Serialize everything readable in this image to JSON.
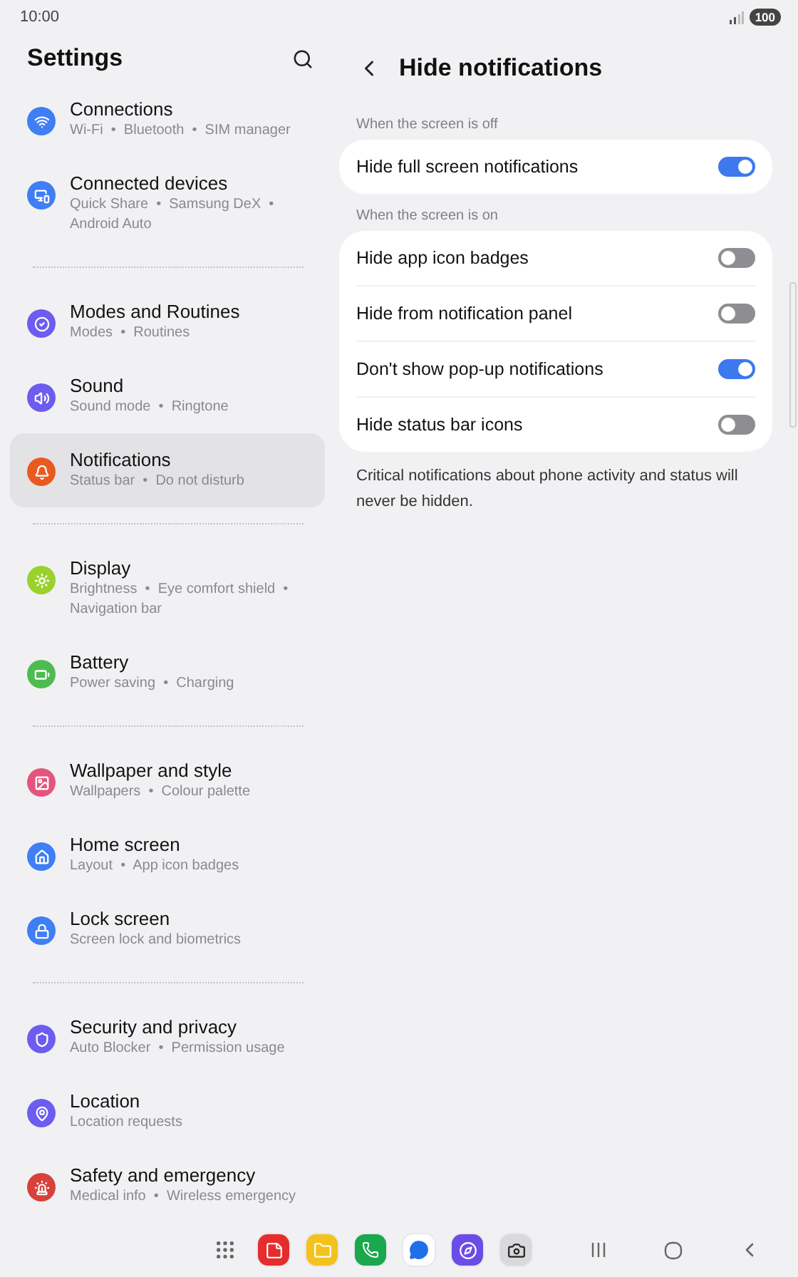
{
  "status_bar": {
    "time": "10:00",
    "battery": "100"
  },
  "sidebar": {
    "title": "Settings",
    "groups": [
      {
        "items": [
          {
            "title": "Connections",
            "subtitle": "Wi-Fi  •  Bluetooth  •  SIM manager",
            "color": "#3f7ef4",
            "selected": false
          },
          {
            "title": "Connected devices",
            "subtitle": "Quick Share  •  Samsung DeX  •  Android Auto",
            "color": "#3f7ef4",
            "selected": false
          }
        ]
      },
      {
        "items": [
          {
            "title": "Modes and Routines",
            "subtitle": "Modes  •  Routines",
            "color": "#6d5cf0",
            "selected": false
          },
          {
            "title": "Sound",
            "subtitle": "Sound mode  •  Ringtone",
            "color": "#6d5cf0",
            "selected": false
          },
          {
            "title": "Notifications",
            "subtitle": "Status bar  •  Do not disturb",
            "color": "#ea5a1f",
            "selected": true
          }
        ]
      },
      {
        "items": [
          {
            "title": "Display",
            "subtitle": "Brightness  •  Eye comfort shield  •  Navigation bar",
            "color": "#9ad12c",
            "selected": false
          },
          {
            "title": "Battery",
            "subtitle": "Power saving  •  Charging",
            "color": "#4dbb4f",
            "selected": false
          }
        ]
      },
      {
        "items": [
          {
            "title": "Wallpaper and style",
            "subtitle": "Wallpapers  •  Colour palette",
            "color": "#e5547c",
            "selected": false
          },
          {
            "title": "Home screen",
            "subtitle": "Layout  •  App icon badges",
            "color": "#3f7ef4",
            "selected": false
          },
          {
            "title": "Lock screen",
            "subtitle": "Screen lock and biometrics",
            "color": "#3f7ef4",
            "selected": false
          }
        ]
      },
      {
        "items": [
          {
            "title": "Security and privacy",
            "subtitle": "Auto Blocker  •  Permission usage",
            "color": "#6d5cf0",
            "selected": false
          },
          {
            "title": "Location",
            "subtitle": "Location requests",
            "color": "#6d5cf0",
            "selected": false
          },
          {
            "title": "Safety and emergency",
            "subtitle": "Medical info  •  Wireless emergency",
            "color": "#d8413b",
            "selected": false
          }
        ]
      }
    ]
  },
  "detail": {
    "title": "Hide notifications",
    "sections": [
      {
        "label": "When the screen is off",
        "rows": [
          {
            "label": "Hide full screen notifications",
            "on": true
          }
        ]
      },
      {
        "label": "When the screen is on",
        "rows": [
          {
            "label": "Hide app icon badges",
            "on": false
          },
          {
            "label": "Hide from notification panel",
            "on": false
          },
          {
            "label": "Don't show pop-up notifications",
            "on": true
          },
          {
            "label": "Hide status bar icons",
            "on": false
          }
        ]
      }
    ],
    "footnote": "Critical notifications about phone activity and status will never be hidden."
  }
}
